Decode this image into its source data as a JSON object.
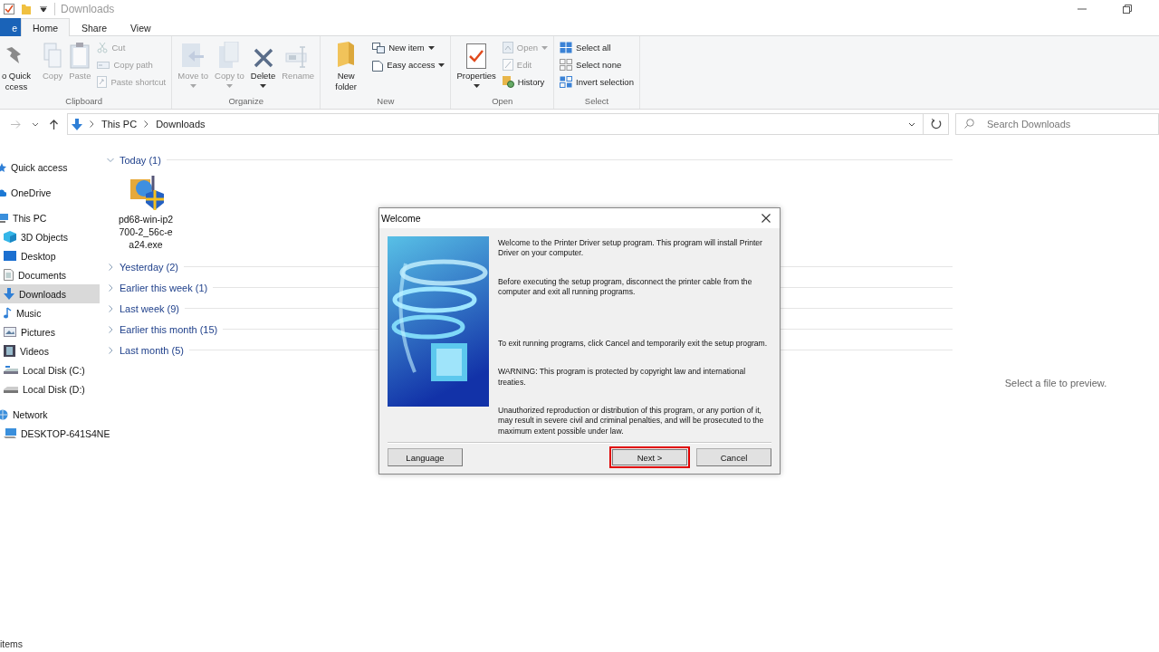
{
  "window": {
    "title": "Downloads"
  },
  "ribbon_tabs": [
    {
      "label": "e",
      "selected": false,
      "kind": "file"
    },
    {
      "label": "Home",
      "selected": true,
      "kind": "tab"
    },
    {
      "label": "Share",
      "selected": false,
      "kind": "tab"
    },
    {
      "label": "View",
      "selected": false,
      "kind": "tab"
    }
  ],
  "ribbon_groups": [
    {
      "label": "Clipboard",
      "items": [
        {
          "kind": "large",
          "label": "o Quick ccess",
          "disabled": false,
          "dropdown": false
        },
        {
          "kind": "large",
          "label": "Copy",
          "disabled": true,
          "dropdown": false
        },
        {
          "kind": "large",
          "label": "Paste",
          "disabled": true,
          "dropdown": false
        },
        {
          "kind": "small",
          "label": "Cut",
          "disabled": true,
          "dropdown": false
        },
        {
          "kind": "small",
          "label": "Copy path",
          "disabled": true,
          "dropdown": false
        },
        {
          "kind": "small",
          "label": "Paste shortcut",
          "disabled": true,
          "dropdown": false
        }
      ]
    },
    {
      "label": "Organize",
      "items": [
        {
          "kind": "large",
          "label": "Move to",
          "disabled": true,
          "dropdown": true
        },
        {
          "kind": "large",
          "label": "Copy to",
          "disabled": true,
          "dropdown": true
        },
        {
          "kind": "large",
          "label": "Delete",
          "disabled": false,
          "dropdown": true
        },
        {
          "kind": "large",
          "label": "Rename",
          "disabled": true,
          "dropdown": false
        }
      ]
    },
    {
      "label": "New",
      "items": [
        {
          "kind": "large",
          "label": "New folder",
          "disabled": false,
          "dropdown": false
        },
        {
          "kind": "small",
          "label": "New item",
          "disabled": false,
          "dropdown": true
        },
        {
          "kind": "small",
          "label": "Easy access",
          "disabled": false,
          "dropdown": true
        }
      ]
    },
    {
      "label": "Open",
      "items": [
        {
          "kind": "large",
          "label": "Properties",
          "disabled": false,
          "dropdown": true
        },
        {
          "kind": "small",
          "label": "Open",
          "disabled": true,
          "dropdown": true
        },
        {
          "kind": "small",
          "label": "Edit",
          "disabled": true,
          "dropdown": false
        },
        {
          "kind": "small",
          "label": "History",
          "disabled": false,
          "dropdown": false
        }
      ]
    },
    {
      "label": "Select",
      "items": [
        {
          "kind": "small",
          "label": "Select all",
          "disabled": false,
          "dropdown": false
        },
        {
          "kind": "small",
          "label": "Select none",
          "disabled": false,
          "dropdown": false
        },
        {
          "kind": "small",
          "label": "Invert selection",
          "disabled": false,
          "dropdown": false
        }
      ]
    }
  ],
  "address": {
    "path": [
      "This PC",
      "Downloads"
    ],
    "search_placeholder": "Search Downloads"
  },
  "sidebar": {
    "items": [
      {
        "label": "Quick access",
        "selected": false
      },
      {
        "label": "OneDrive",
        "selected": false
      },
      {
        "label": "This PC",
        "selected": false,
        "children": [
          {
            "label": "3D Objects",
            "selected": false
          },
          {
            "label": "Desktop",
            "selected": false
          },
          {
            "label": "Documents",
            "selected": false
          },
          {
            "label": "Downloads",
            "selected": true
          },
          {
            "label": "Music",
            "selected": false
          },
          {
            "label": "Pictures",
            "selected": false
          },
          {
            "label": "Videos",
            "selected": false
          },
          {
            "label": "Local Disk (C:)",
            "selected": false
          },
          {
            "label": "Local Disk (D:)",
            "selected": false
          }
        ]
      },
      {
        "label": "Network",
        "selected": false,
        "children": [
          {
            "label": "DESKTOP-641S4NE",
            "selected": false
          }
        ]
      }
    ]
  },
  "file_groups": [
    {
      "label": "Today (1)",
      "expanded": true,
      "files": [
        {
          "name": "pd68-win-ip2700-2_56c-ea24.exe"
        }
      ]
    },
    {
      "label": "Yesterday (2)",
      "expanded": false
    },
    {
      "label": "Earlier this week (1)",
      "expanded": false
    },
    {
      "label": "Last week (9)",
      "expanded": false
    },
    {
      "label": "Earlier this month (15)",
      "expanded": false
    },
    {
      "label": "Last month (5)",
      "expanded": false
    }
  ],
  "preview": {
    "message": "Select a file to preview."
  },
  "dialog": {
    "title": "Welcome",
    "paragraphs": [
      "Welcome to the Printer Driver setup program. This program will install Printer Driver on your computer.",
      "Before executing the setup program, disconnect the printer cable from the computer and exit all running programs.",
      "To exit running programs, click Cancel and temporarily exit the setup program.",
      "WARNING: This program is protected by copyright law and international treaties.",
      "Unauthorized reproduction or distribution of this program, or any portion of it, may result in severe civil and criminal penalties, and will be prosecuted to the maximum extent possible under law."
    ],
    "buttons": [
      {
        "label": "Language",
        "highlighted": false,
        "kind": "left"
      },
      {
        "label": "Next >",
        "highlighted": true,
        "kind": "right"
      },
      {
        "label": "Cancel",
        "highlighted": false,
        "kind": "right"
      }
    ]
  },
  "status_bar": {
    "text": "items"
  }
}
